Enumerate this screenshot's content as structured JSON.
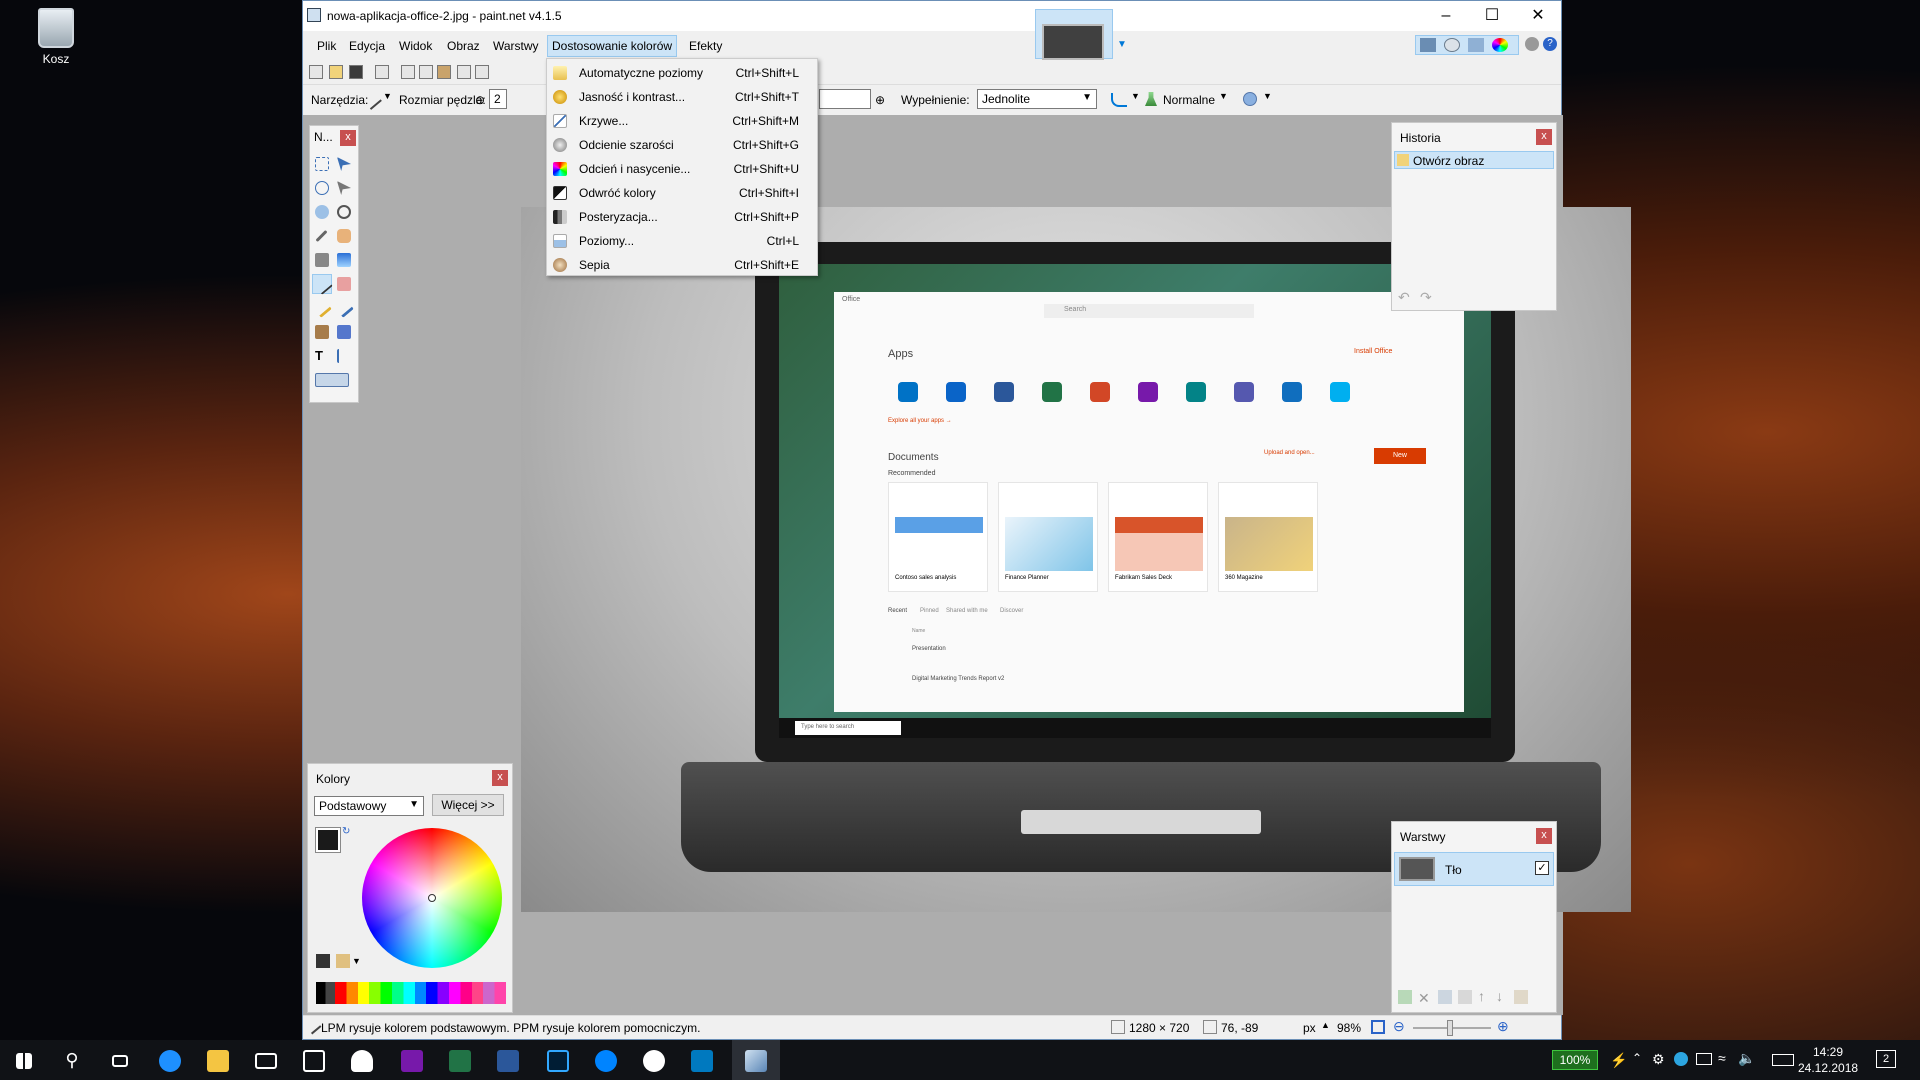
{
  "desktop": {
    "recycle_bin_label": "Kosz"
  },
  "window": {
    "title": "nowa-aplikacja-office-2.jpg - paint.net v4.1.5",
    "menu": [
      "Plik",
      "Edycja",
      "Widok",
      "Obraz",
      "Warstwy",
      "Dostosowanie kolorów",
      "Efekty"
    ],
    "active_menu": "Dostosowanie kolorów"
  },
  "toolbar": {
    "tools_label": "Narzędzia:",
    "brush_size_label": "Rozmiar pędzla:",
    "brush_size_value": "2",
    "fill_label": "Wypełnienie:",
    "fill_value": "Jednolite",
    "blend_mode": "Normalne"
  },
  "dropdown": {
    "items": [
      {
        "label": "Automatyczne poziomy",
        "shortcut": "Ctrl+Shift+L",
        "icon": "auto-level-icon"
      },
      {
        "label": "Jasność i kontrast...",
        "shortcut": "Ctrl+Shift+T",
        "icon": "brightness-contrast-icon"
      },
      {
        "label": "Krzywe...",
        "shortcut": "Ctrl+Shift+M",
        "icon": "curves-icon"
      },
      {
        "label": "Odcienie szarości",
        "shortcut": "Ctrl+Shift+G",
        "icon": "grayscale-icon"
      },
      {
        "label": "Odcień i nasycenie...",
        "shortcut": "Ctrl+Shift+U",
        "icon": "hue-saturation-icon"
      },
      {
        "label": "Odwróć kolory",
        "shortcut": "Ctrl+Shift+I",
        "icon": "invert-colors-icon"
      },
      {
        "label": "Posteryzacja...",
        "shortcut": "Ctrl+Shift+P",
        "icon": "posterize-icon"
      },
      {
        "label": "Poziomy...",
        "shortcut": "Ctrl+L",
        "icon": "levels-icon"
      },
      {
        "label": "Sepia",
        "shortcut": "Ctrl+Shift+E",
        "icon": "sepia-icon"
      }
    ]
  },
  "tools_panel": {
    "title": "N..."
  },
  "history_panel": {
    "title": "Historia",
    "items": [
      "Otwórz obraz"
    ]
  },
  "layers_panel": {
    "title": "Warstwy",
    "layers": [
      {
        "name": "Tło",
        "visible": true
      }
    ]
  },
  "colors_panel": {
    "title": "Kolory",
    "palette_mode": "Podstawowy",
    "more_button": "Więcej >>"
  },
  "statusbar": {
    "hint": "LPM rysuje kolorem podstawowym. PPM rysuje kolorem pomocniczym.",
    "image_size": "1280 × 720",
    "cursor_pos": "76, -89",
    "units": "px",
    "zoom": "98%"
  },
  "embedded_image": {
    "office_header": "Office",
    "search_placeholder": "Search",
    "apps_heading": "Apps",
    "install_office": "Install Office",
    "apps": [
      "Outlook",
      "OneDrive",
      "Word",
      "Excel",
      "PowerPoint",
      "OneNote",
      "SharePoint",
      "Teams",
      "Yammer",
      "Skype"
    ],
    "explore_link": "Explore all your apps →",
    "documents_heading": "Documents",
    "upload_open": "Upload and open...",
    "new_button": "New",
    "recommended": "Recommended",
    "docs": [
      "Contoso sales analysis",
      "Finance Planner",
      "Fabrikam Sales Deck",
      "360 Magazine"
    ],
    "tabs": [
      "Recent",
      "Pinned",
      "Shared with me",
      "Discover"
    ],
    "list_header_name": "Name",
    "recent_items": [
      "Presentation",
      "Digital Marketing Trends Report v2"
    ],
    "taskbar_search": "Type here to search"
  },
  "taskbar": {
    "battery": "100%",
    "time": "14:29",
    "date": "24.12.2018",
    "notification_count": "2"
  },
  "colors": {
    "accent": "#0078d7",
    "menu_highlight": "#cce4f7",
    "panel_close": "#c75050"
  }
}
